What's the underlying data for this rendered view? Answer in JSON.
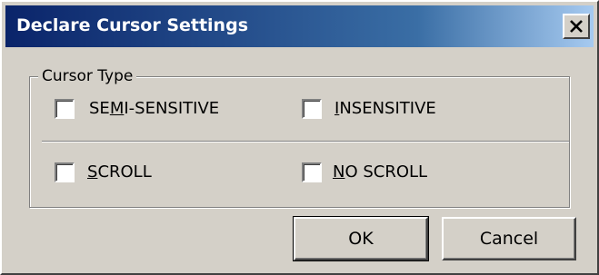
{
  "window": {
    "title": "Declare Cursor Settings",
    "close_symbol": "close-icon"
  },
  "group": {
    "legend": "Cursor Type",
    "options": [
      {
        "label_pre": "SE",
        "label_mn": "M",
        "label_post": "I-SENSITIVE",
        "checked": false
      },
      {
        "label_pre": "",
        "label_mn": "I",
        "label_post": "NSENSITIVE",
        "checked": false
      },
      {
        "label_pre": "",
        "label_mn": "S",
        "label_post": "CROLL",
        "checked": false
      },
      {
        "label_pre": "",
        "label_mn": "N",
        "label_post": "O SCROLL",
        "checked": false
      }
    ]
  },
  "buttons": {
    "ok_label": "OK",
    "cancel_label": "Cancel"
  }
}
